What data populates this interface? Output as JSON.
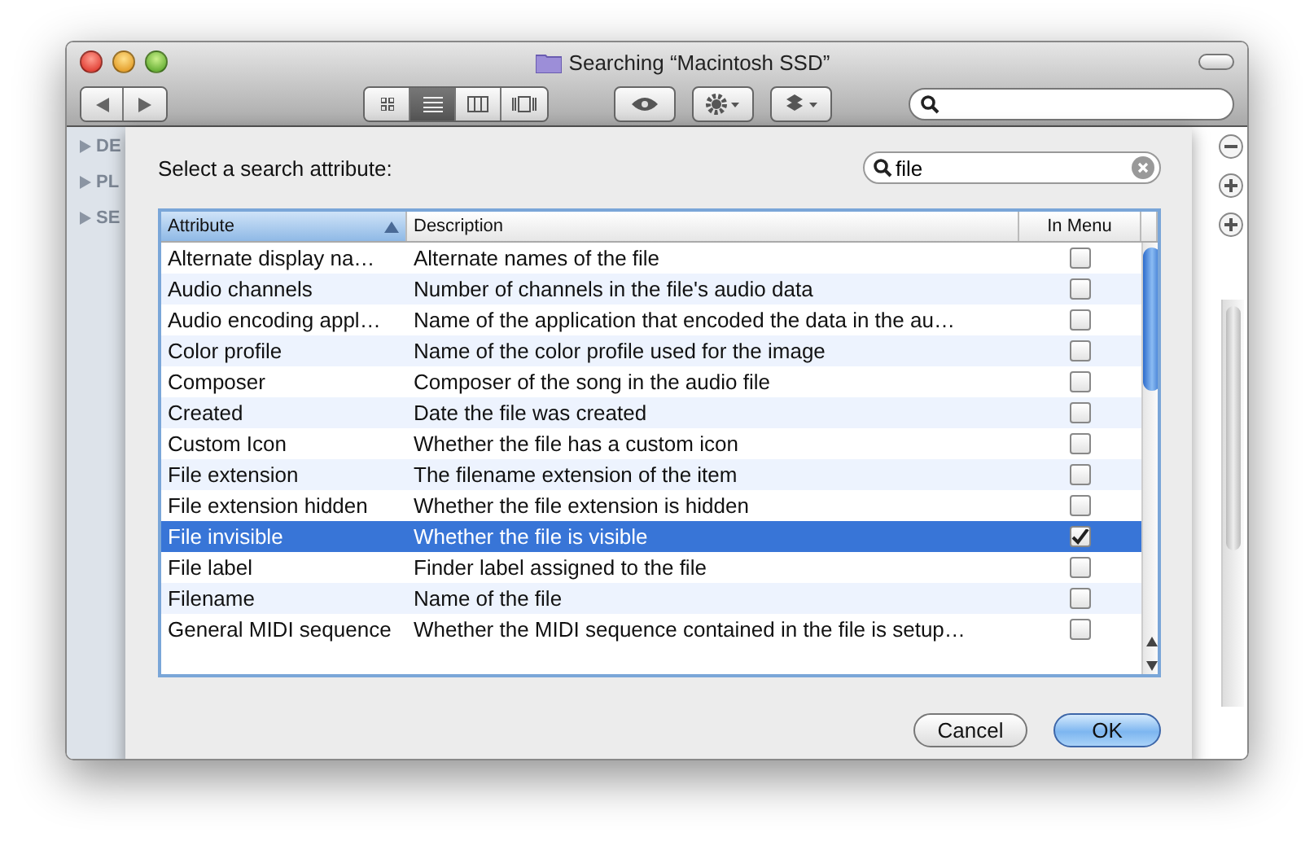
{
  "window": {
    "title": "Searching “Macintosh SSD”"
  },
  "sidebar": {
    "headings": [
      "DE",
      "PL",
      "SE"
    ]
  },
  "sheet": {
    "prompt": "Select a search attribute:",
    "search": {
      "value": "file"
    },
    "table": {
      "columns": [
        {
          "label": "Attribute",
          "sorted": true
        },
        {
          "label": "Description",
          "sorted": false
        },
        {
          "label": "In Menu",
          "sorted": false
        }
      ],
      "rows": [
        {
          "attribute": "Alternate display na…",
          "description": "Alternate names of the file",
          "checked": false,
          "selected": false
        },
        {
          "attribute": "Audio channels",
          "description": "Number of channels in the file's audio data",
          "checked": false,
          "selected": false
        },
        {
          "attribute": "Audio encoding appl…",
          "description": "Name of the application that encoded the data in the au…",
          "checked": false,
          "selected": false
        },
        {
          "attribute": "Color profile",
          "description": "Name of the color profile used for the image",
          "checked": false,
          "selected": false
        },
        {
          "attribute": "Composer",
          "description": "Composer of the song in the audio file",
          "checked": false,
          "selected": false
        },
        {
          "attribute": "Created",
          "description": "Date the file was created",
          "checked": false,
          "selected": false
        },
        {
          "attribute": "Custom Icon",
          "description": "Whether the file has a custom icon",
          "checked": false,
          "selected": false
        },
        {
          "attribute": "File extension",
          "description": "The filename extension of the item",
          "checked": false,
          "selected": false
        },
        {
          "attribute": "File extension hidden",
          "description": "Whether the file extension is hidden",
          "checked": false,
          "selected": false
        },
        {
          "attribute": "File invisible",
          "description": "Whether the file is visible",
          "checked": true,
          "selected": true
        },
        {
          "attribute": "File label",
          "description": "Finder label assigned to the file",
          "checked": false,
          "selected": false
        },
        {
          "attribute": "Filename",
          "description": "Name of the file",
          "checked": false,
          "selected": false
        },
        {
          "attribute": "General MIDI sequence",
          "description": "Whether the MIDI sequence contained in the file is setup…",
          "checked": false,
          "selected": false
        }
      ]
    },
    "buttons": [
      {
        "label": "Cancel",
        "kind": "secondary"
      },
      {
        "label": "OK",
        "kind": "default"
      }
    ]
  }
}
